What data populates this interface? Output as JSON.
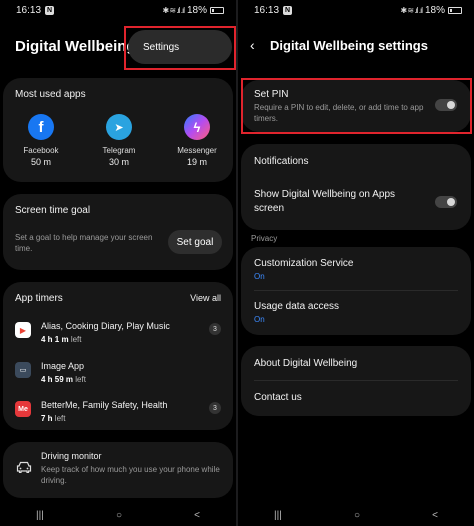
{
  "status_left": {
    "time": "16:13",
    "badge": "N",
    "indicators": "✱ ≋ .ıl .ıl",
    "battery": "18%"
  },
  "status_right": {
    "time": "16:13",
    "badge": "N",
    "indicators": "✱ ≋ .ıl .ıl",
    "battery": "18%"
  },
  "left": {
    "title": "Digital Wellbeing",
    "popup_label": "Settings",
    "most_used": {
      "heading": "Most used apps",
      "apps": [
        {
          "name": "Facebook",
          "time": "50 m",
          "icon": "facebook-icon",
          "color": "#1877f2",
          "glyph": "f"
        },
        {
          "name": "Telegram",
          "time": "30 m",
          "icon": "telegram-icon",
          "color": "#2aa3e0",
          "glyph": "➤"
        },
        {
          "name": "Messenger",
          "time": "19 m",
          "icon": "messenger-icon",
          "color": "#8a5cf6",
          "glyph": "ϟ"
        }
      ]
    },
    "goal": {
      "heading": "Screen time goal",
      "desc": "Set a goal to help manage your screen time.",
      "button": "Set goal"
    },
    "timers": {
      "heading": "App timers",
      "view_all": "View all",
      "items": [
        {
          "title": "Alias, Cooking Diary, Play Music",
          "time": "4 h 1 m",
          "suffix": "left",
          "count": "3",
          "icon": "play-store-icon",
          "color": "#ffffff",
          "glyph": "▶"
        },
        {
          "title": "Image App",
          "time": "4 h 59 m",
          "suffix": "left",
          "count": "",
          "icon": "image-app-icon",
          "color": "#3b4a5c",
          "glyph": "▭"
        },
        {
          "title": "BetterMe, Family Safety, Health",
          "time": "7 h",
          "suffix": "left",
          "count": "3",
          "icon": "betterme-icon",
          "color": "#e5383b",
          "glyph": "Me"
        }
      ]
    },
    "driving": {
      "title": "Driving monitor",
      "desc": "Keep track of how much you use your phone while driving."
    }
  },
  "right": {
    "title": "Digital Wellbeing settings",
    "pin": {
      "title": "Set PIN",
      "desc": "Require a PIN to edit, delete, or add time to app timers."
    },
    "notifications": "Notifications",
    "show_on_apps": "Show Digital Wellbeing on Apps screen",
    "privacy_label": "Privacy",
    "customization": {
      "title": "Customization Service",
      "status": "On"
    },
    "usage": {
      "title": "Usage data access",
      "status": "On"
    },
    "about": "About Digital Wellbeing",
    "contact": "Contact us"
  },
  "nav": {
    "recents": "|||",
    "home": "○",
    "back": "<"
  },
  "colors": {
    "highlight": "#e0242d",
    "accent_blue": "#3d8bff"
  }
}
